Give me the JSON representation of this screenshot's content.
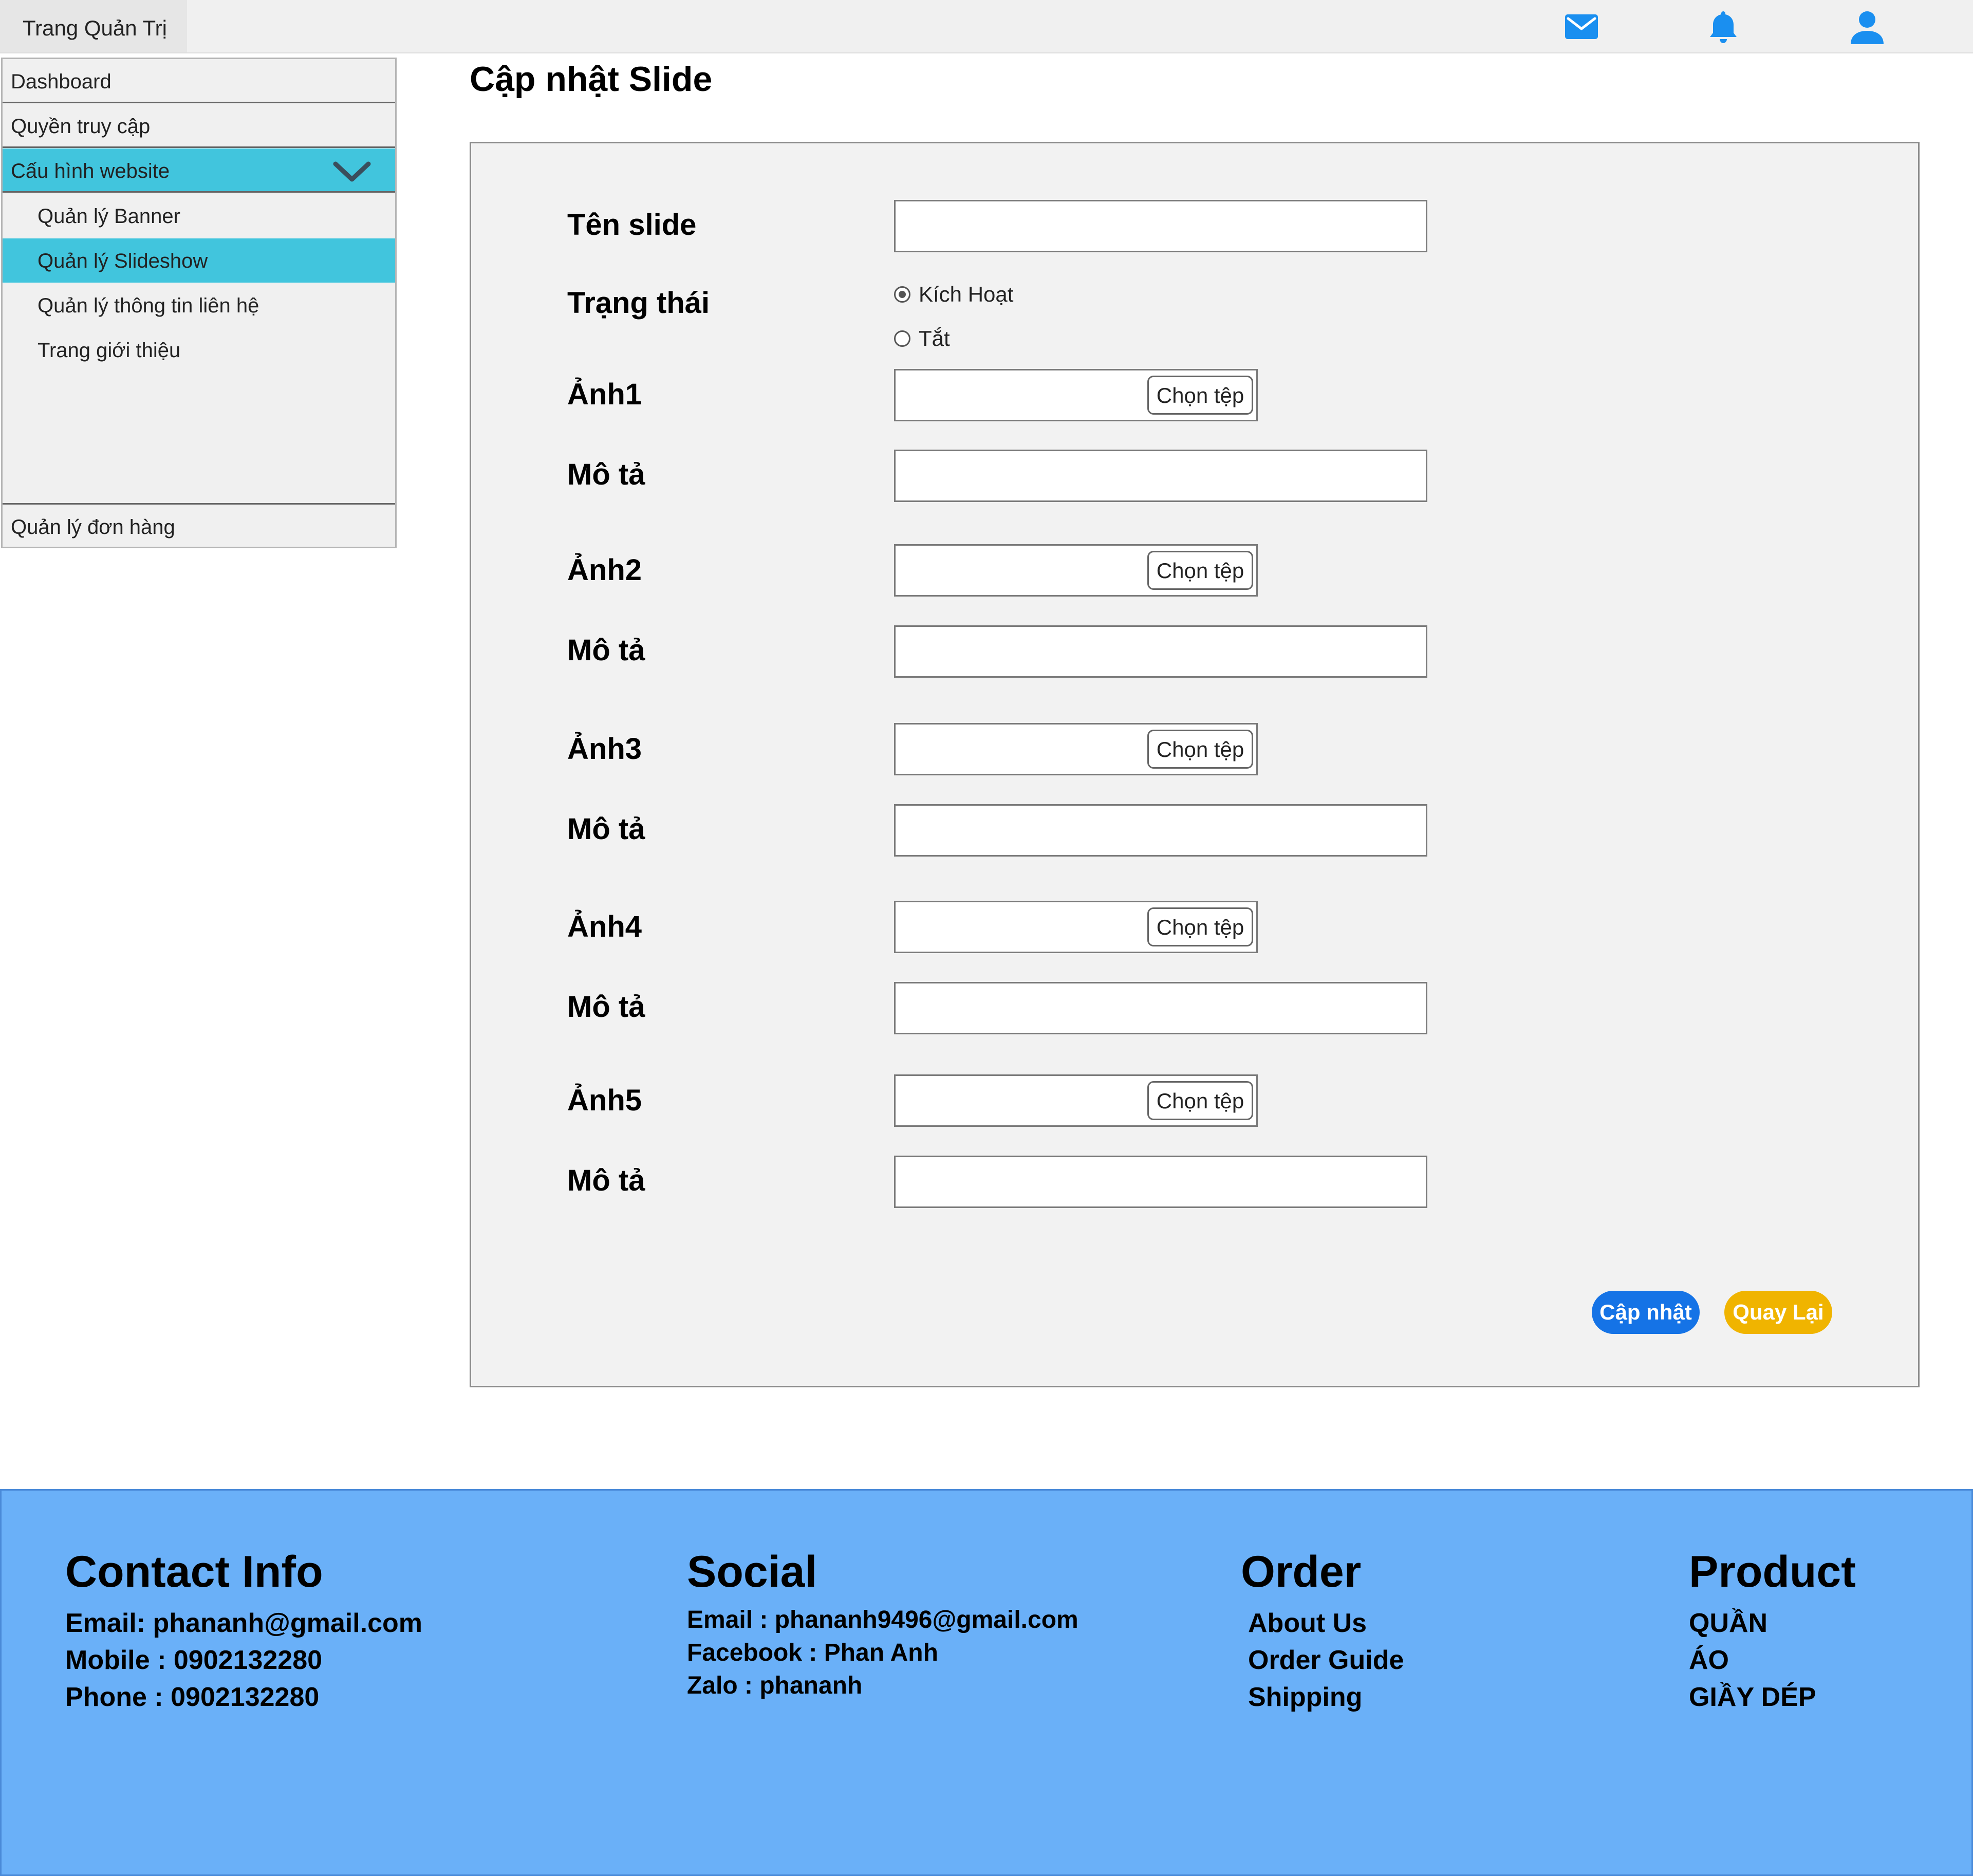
{
  "header": {
    "brand": "Trang Quản Trị",
    "icons": [
      "mail-icon",
      "bell-icon",
      "user-icon"
    ],
    "icon_color": "#1a8ff0"
  },
  "sidebar": {
    "items": [
      {
        "label": "Dashboard"
      },
      {
        "label": "Quyền truy cập"
      },
      {
        "label": "Cấu hình website",
        "active": true,
        "expanded": true
      },
      {
        "label": "Quản lý Banner"
      },
      {
        "label": "Quản lý Slideshow",
        "active": true
      },
      {
        "label": "Quản lý thông tin liên hệ"
      },
      {
        "label": "Trang giới thiệu"
      },
      {
        "label": "Quản lý đơn hàng"
      }
    ],
    "active_color": "#41c5dd"
  },
  "main": {
    "title": "Cập nhật Slide",
    "form": {
      "name_label": "Tên slide",
      "name_value": "",
      "status_label": "Trạng thái",
      "status_options": [
        "Kích Hoạt",
        "Tắt"
      ],
      "status_selected": "Kích Hoạt",
      "file_button": "Chọn tệp",
      "images": [
        {
          "label": "Ảnh1",
          "desc_label": "Mô tả",
          "desc_value": ""
        },
        {
          "label": "Ảnh2",
          "desc_label": "Mô tả",
          "desc_value": ""
        },
        {
          "label": "Ảnh3",
          "desc_label": "Mô tả",
          "desc_value": ""
        },
        {
          "label": "Ảnh4",
          "desc_label": "Mô tả",
          "desc_value": ""
        },
        {
          "label": "Ảnh5",
          "desc_label": "Mô tả",
          "desc_value": ""
        }
      ],
      "update_button": "Cập nhật",
      "back_button": "Quay Lại",
      "update_color": "#1573e6",
      "back_color": "#f0b400"
    }
  },
  "footer": {
    "background": "#6ab0f8",
    "contact": {
      "title": "Contact Info",
      "lines": [
        "Email: phananh@gmail.com",
        "Mobile : 0902132280",
        "Phone : 0902132280"
      ]
    },
    "social": {
      "title": "Social",
      "lines": [
        "Email : phananh9496@gmail.com",
        "Facebook : Phan Anh",
        "Zalo : phananh"
      ]
    },
    "order": {
      "title": "Order",
      "lines": [
        "About Us",
        "Order Guide",
        "Shipping"
      ]
    },
    "product": {
      "title": "Product",
      "lines": [
        "QUẦN",
        "ÁO",
        "GIẦY DÉP"
      ]
    }
  }
}
